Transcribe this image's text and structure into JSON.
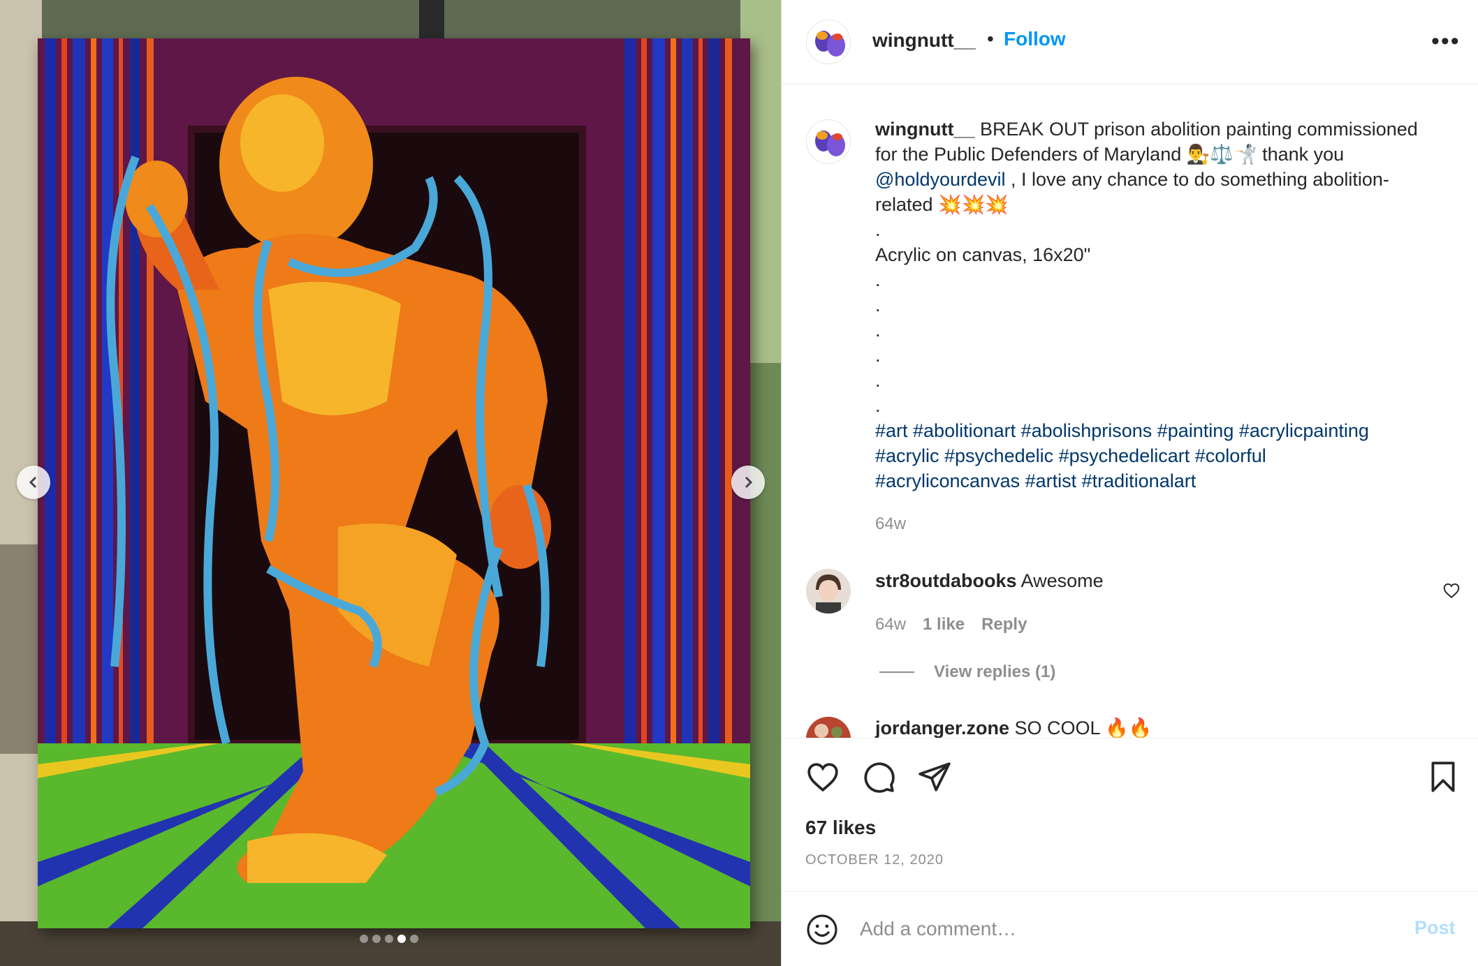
{
  "post": {
    "username": "wingnutt__",
    "separator": "•",
    "follow_label": "Follow",
    "more_label": "•••"
  },
  "caption": {
    "username": "wingnutt__",
    "line1": " BREAK OUT prison abolition painting commissioned",
    "line2": "for the Public Defenders of Maryland 👨‍⚖️⚖️🤺 thank you",
    "mention": "@holdyourdevil",
    "line3_rest": " , I love any chance to do something abolition-",
    "line4": "related 💥💥💥",
    "dot": ".",
    "line6": "Acrylic on canvas, 16x20\"",
    "hashtags_line1": "#art #abolitionart #abolishprisons #painting #acrylicpainting",
    "hashtags_line2": "#acrylic #psychedelic #psychedelicart #colorful",
    "hashtags_line3": "#acryliconcanvas #artist #traditionalart",
    "time": "64w"
  },
  "comments": [
    {
      "username": "str8outdabooks",
      "text": " Awesome",
      "time": "64w",
      "likes": "1 like",
      "reply": "Reply",
      "view_replies": "View replies (1)"
    },
    {
      "username": "jordanger.zone",
      "text": " SO COOL 🔥🔥"
    }
  ],
  "actions": {
    "icons": [
      "heart-icon",
      "comment-icon",
      "share-icon",
      "bookmark-icon"
    ],
    "likes": "67 likes",
    "date": "OCTOBER 12, 2020"
  },
  "add_comment": {
    "placeholder": "Add a comment…",
    "post_label": "Post"
  },
  "carousel": {
    "slide_count": 5,
    "active_index": 3
  },
  "colors": {
    "accent": "#0095f6",
    "link": "#00376b",
    "muted": "#8e8e8e",
    "post_disabled": "#b2dffc"
  }
}
